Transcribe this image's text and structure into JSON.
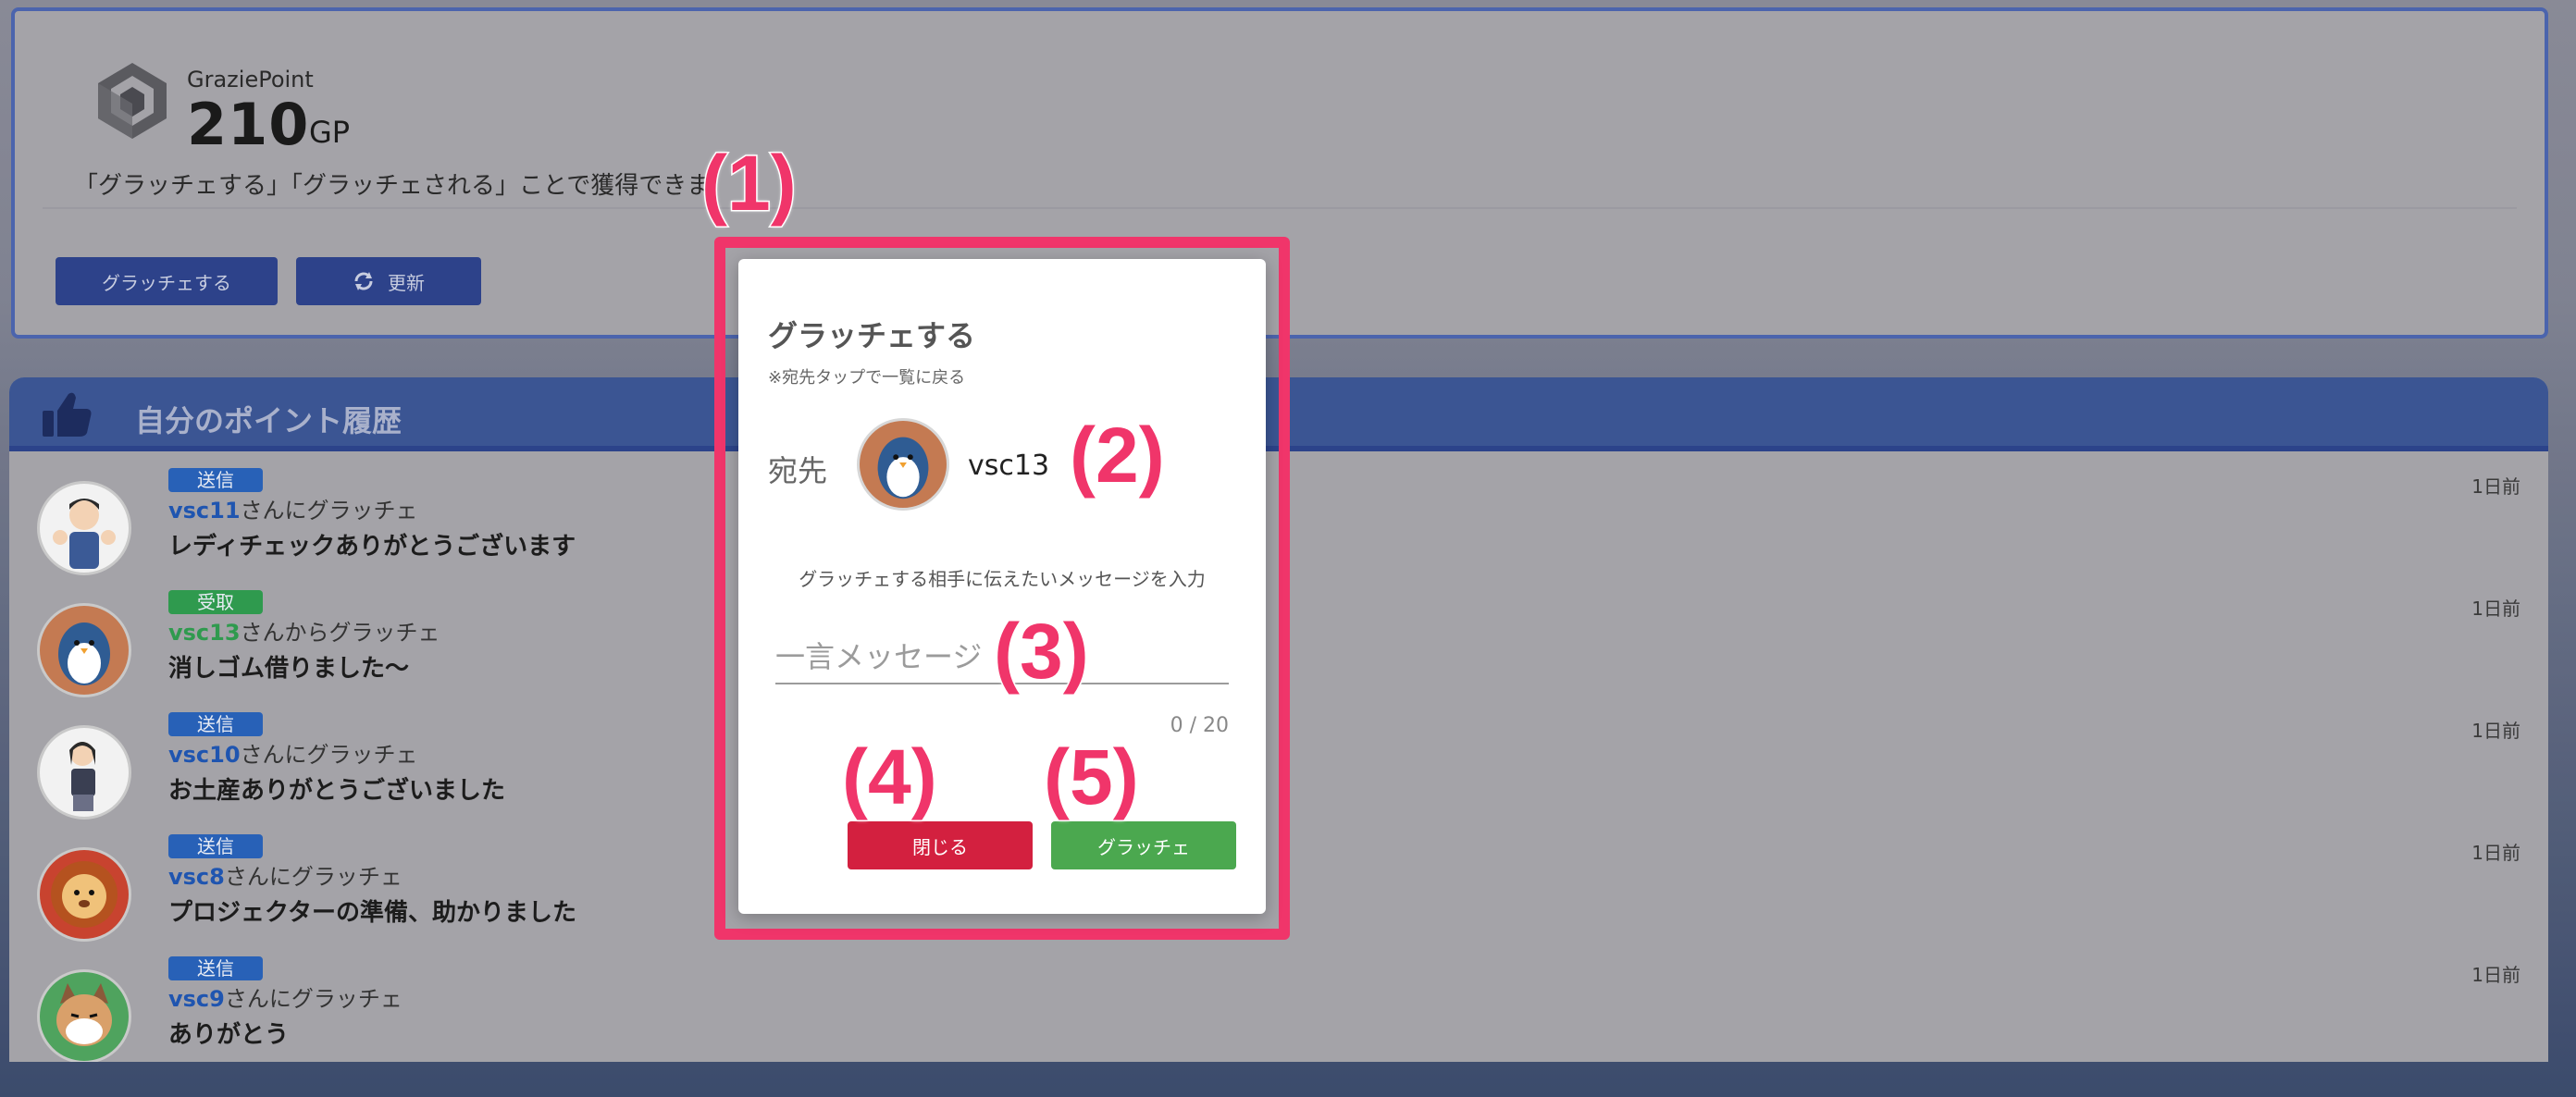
{
  "points": {
    "brand": "GraziePoint",
    "amount": "210",
    "unit": "GP",
    "description": "「グラッチェする」「グラッチェされる」ことで獲得できま",
    "gratitude_button": "グラッチェする",
    "refresh_button": "更新"
  },
  "history": {
    "title": "自分のポイント履歴",
    "rows": [
      {
        "badge": "送信",
        "type": "send",
        "user": "vsc11",
        "suffix": "さんにグラッチェ",
        "message": "レディチェックありがとうございます",
        "time": "1日前",
        "avatar_color": "#f2f2f2"
      },
      {
        "badge": "受取",
        "type": "recv",
        "user": "vsc13",
        "suffix": "さんからグラッチェ",
        "message": "消しゴム借りました〜",
        "time": "1日前",
        "avatar_color": "#c47a52"
      },
      {
        "badge": "送信",
        "type": "send",
        "user": "vsc10",
        "suffix": "さんにグラッチェ",
        "message": "お土産ありがとうございました",
        "time": "1日前",
        "avatar_color": "#f2f2f2"
      },
      {
        "badge": "送信",
        "type": "send",
        "user": "vsc8",
        "suffix": "さんにグラッチェ",
        "message": "プロジェクターの準備、助かりました",
        "time": "1日前",
        "avatar_color": "#c8432f"
      },
      {
        "badge": "送信",
        "type": "send",
        "user": "vsc9",
        "suffix": "さんにグラッチェ",
        "message": "ありがとう",
        "time": "1日前",
        "avatar_color": "#4fa35e"
      }
    ]
  },
  "modal": {
    "title": "グラッチェする",
    "hint": "※宛先タップで一覧に戻る",
    "to_label": "宛先",
    "to_name": "vsc13",
    "prompt": "グラッチェする相手に伝えたいメッセージを入力",
    "input_value": "",
    "input_placeholder": "一言メッセージ",
    "counter": "0 / 20",
    "close_button": "閉じる",
    "send_button": "グラッチェ"
  },
  "annotations": [
    "(1)",
    "(2)",
    "(3)",
    "(4)",
    "(5)"
  ],
  "colors": {
    "accent_pink": "#f0356a",
    "send_badge": "#2861b7",
    "recv_badge": "#2f9a4e",
    "close_red": "#d3203f",
    "send_green": "#4ba84f",
    "header_blue": "#3b5593"
  }
}
